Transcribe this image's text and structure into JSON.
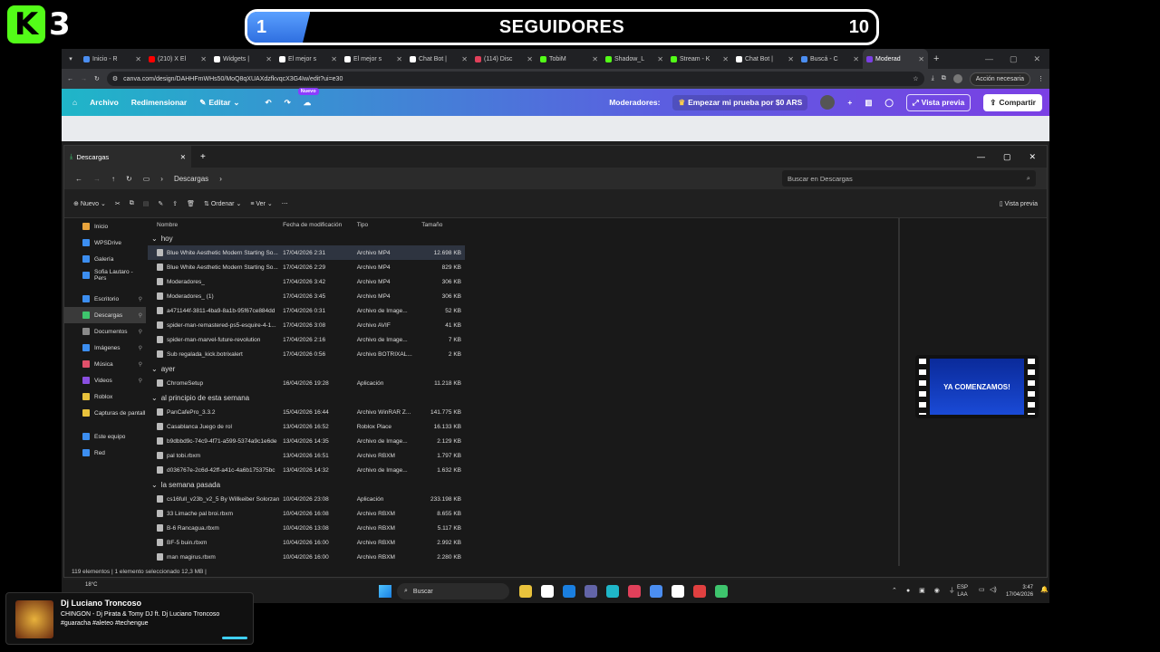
{
  "overlay": {
    "logo_letter": "K",
    "logo_number": "3",
    "goal": {
      "current": "1",
      "title": "SEGUIDORES",
      "target": "10",
      "progress": 0.1
    }
  },
  "browser": {
    "tabs": [
      {
        "label": "Inicio - R",
        "color": "#4b8ef1"
      },
      {
        "label": "(210) X El",
        "color": "#ff0000"
      },
      {
        "label": "Widgets |",
        "color": "#ffffff"
      },
      {
        "label": "El mejor s",
        "color": "#ffffff"
      },
      {
        "label": "El mejor s",
        "color": "#ffffff"
      },
      {
        "label": "Chat Bot |",
        "color": "#ffffff"
      },
      {
        "label": "(114) Disc",
        "color": "#e0405a"
      },
      {
        "label": "TobiM",
        "color": "#53fc18"
      },
      {
        "label": "Shadow_L",
        "color": "#53fc18"
      },
      {
        "label": "Stream - K",
        "color": "#53fc18"
      },
      {
        "label": "Chat Bot |",
        "color": "#ffffff"
      },
      {
        "label": "Buscá - C",
        "color": "#4b8ef1"
      },
      {
        "label": "Moderad",
        "color": "#7b3fe4"
      }
    ],
    "url": "canva.com/design/DAHHFmWHs50/MoQ8qXUAXdzfkvqcX3G4Iw/edit?ui=e30",
    "action_label": "Acción necesaria",
    "canva": {
      "archivo": "Archivo",
      "redimensionar": "Redimensionar",
      "editar": "Editar",
      "nuevo": "Nuevo",
      "moderadores": "Moderadores:",
      "trial": "Empezar mi prueba por $0 ARS",
      "preview": "Vista previa",
      "share": "Compartir"
    }
  },
  "explorer": {
    "tab_title": "Descargas",
    "breadcrumb": "Descargas",
    "search_placeholder": "Buscar en Descargas",
    "toolbar": {
      "nuevo": "Nuevo",
      "ordenar": "Ordenar",
      "ver": "Ver",
      "vista_previa": "Vista previa"
    },
    "sidebar": [
      {
        "label": "Inicio",
        "color": "#e8a33c"
      },
      {
        "label": "WPSDrive",
        "color": "#3c8ef0"
      },
      {
        "label": "Galería",
        "color": "#3c8ef0"
      },
      {
        "label": "Sofia Lautaro - Pers",
        "color": "#3c8ef0"
      },
      {
        "label": "",
        "color": ""
      },
      {
        "label": "Escritorio",
        "color": "#3c8ef0"
      },
      {
        "label": "Descargas",
        "color": "#3ec46d"
      },
      {
        "label": "Documentos",
        "color": "#8a8a8a"
      },
      {
        "label": "Imágenes",
        "color": "#3c8ef0"
      },
      {
        "label": "Música",
        "color": "#e0506a"
      },
      {
        "label": "Videos",
        "color": "#8a4fe0"
      },
      {
        "label": "Roblox",
        "color": "#e8c23c"
      },
      {
        "label": "Capturas de pantall",
        "color": "#e8c23c"
      },
      {
        "label": "",
        "color": ""
      },
      {
        "label": "Este equipo",
        "color": "#3c8ef0"
      },
      {
        "label": "Red",
        "color": "#3c8ef0"
      }
    ],
    "headers": {
      "name": "Nombre",
      "date": "Fecha de modificación",
      "type": "Tipo",
      "size": "Tamaño"
    },
    "groups": [
      {
        "label": "hoy",
        "rows": [
          [
            "Blue White Aesthetic Modern Starting So...",
            "17/04/2026 2:31",
            "Archivo MP4",
            "12.698 KB"
          ],
          [
            "Blue White Aesthetic Modern Starting So...",
            "17/04/2026 2:29",
            "Archivo MP4",
            "829 KB"
          ],
          [
            "Moderadores_",
            "17/04/2026 3:42",
            "Archivo MP4",
            "306 KB"
          ],
          [
            "Moderadores_ (1)",
            "17/04/2026 3:45",
            "Archivo MP4",
            "306 KB"
          ],
          [
            "a471144f-3811-4ba9-8a1b-95f67ce884dd",
            "17/04/2026 0:31",
            "Archivo de Image...",
            "52 KB"
          ],
          [
            "spider-man-remastered-ps5-esquire-4-1...",
            "17/04/2026 3:08",
            "Archivo AVIF",
            "41 KB"
          ],
          [
            "spider-man-marvel-future-revolution",
            "17/04/2026 2:16",
            "Archivo de Image...",
            "7 KB"
          ],
          [
            "Sub regalada_kick.botrixalert",
            "17/04/2026 0:56",
            "Archivo BOTRIXAL...",
            "2 KB"
          ]
        ]
      },
      {
        "label": "ayer",
        "rows": [
          [
            "ChromeSetup",
            "16/04/2026 19:28",
            "Aplicación",
            "11.218 KB"
          ]
        ]
      },
      {
        "label": "al principio de esta semana",
        "rows": [
          [
            "PanCafePro_3.3.2",
            "15/04/2026 16:44",
            "Archivo WinRAR Z...",
            "141.775 KB"
          ],
          [
            "Casablanca Juego de rol",
            "13/04/2026 16:52",
            "Roblox Place",
            "16.133 KB"
          ],
          [
            "b9dbbd9c-74c9-4f71-a599-5374a9c1e6de",
            "13/04/2026 14:35",
            "Archivo de Image...",
            "2.129 KB"
          ],
          [
            "pal tobi.rbxm",
            "13/04/2026 16:51",
            "Archivo RBXM",
            "1.797 KB"
          ],
          [
            "d036767e-2c6d-42ff-a41c-4a6b175375bc",
            "13/04/2026 14:32",
            "Archivo de Image...",
            "1.632 KB"
          ]
        ]
      },
      {
        "label": "la semana pasada",
        "rows": [
          [
            "cs16full_v23b_v2_5 By Willkeiber Solorzano",
            "10/04/2026 23:08",
            "Aplicación",
            "233.198 KB"
          ],
          [
            "33 Limache pal broi.rbxm",
            "10/04/2026 16:08",
            "Archivo RBXM",
            "8.655 KB"
          ],
          [
            "B-6 Rancagua.rbxm",
            "10/04/2026 13:08",
            "Archivo RBXM",
            "5.117 KB"
          ],
          [
            "BF-5 buin.rbxm",
            "10/04/2026 16:00",
            "Archivo RBXM",
            "2.992 KB"
          ],
          [
            "man magirus.rbxm",
            "10/04/2026 16:00",
            "Archivo RBXM",
            "2.280 KB"
          ]
        ]
      }
    ],
    "status": "119 elementos  |  1 elemento seleccionado  12,3 MB  |"
  },
  "preview_video": {
    "text": "YA COMENZAMOS!"
  },
  "taskbar": {
    "search": "Buscar",
    "lang1": "ESP",
    "lang2": "LAA",
    "time": "3:47",
    "date": "17/04/2026",
    "temp": "18°C"
  },
  "notification": {
    "title": "Dj Luciano Troncoso",
    "line1": "CHINGON - Dj Pirata & Tomy DJ ft. Dj Luciano Troncoso",
    "line2": "#guaracha #aleteo #techengue"
  }
}
